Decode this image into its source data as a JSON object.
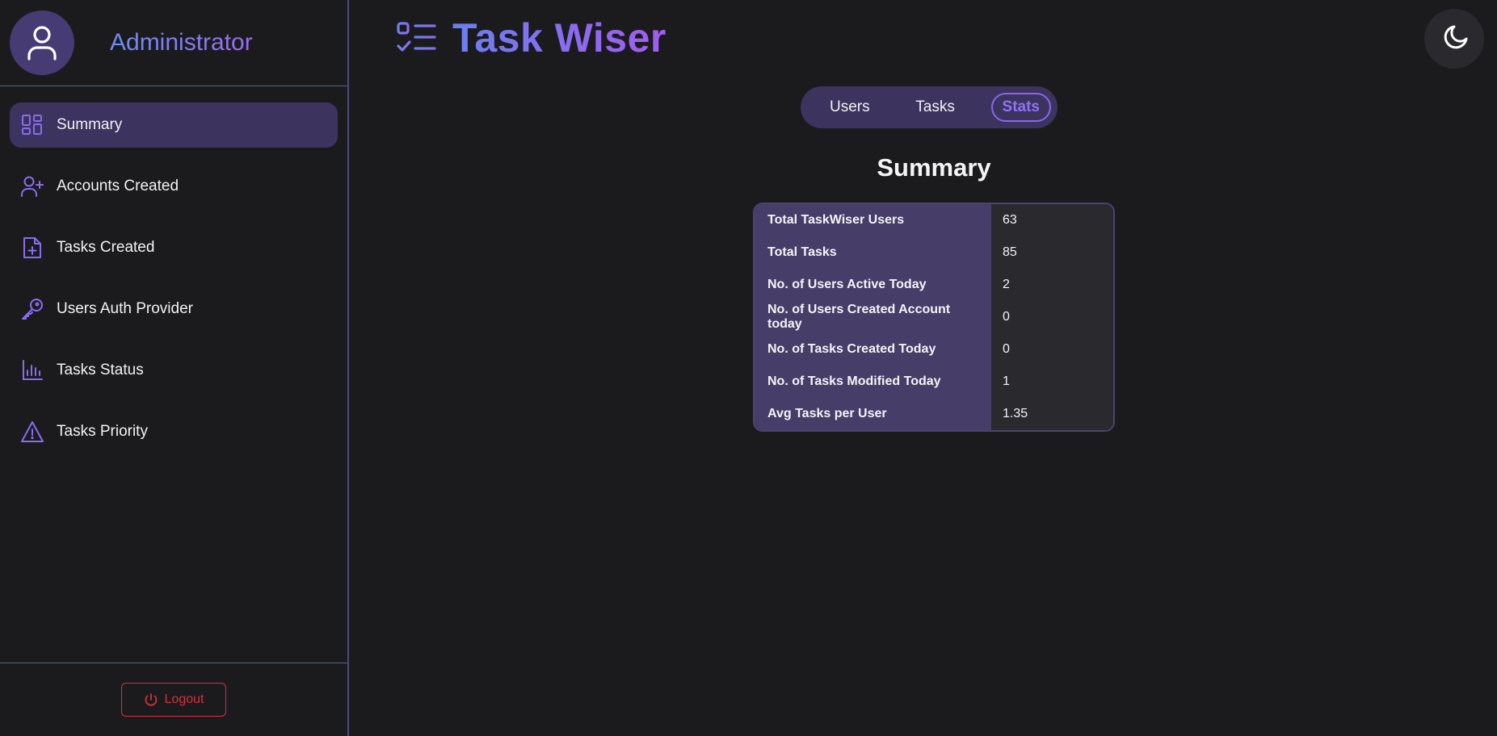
{
  "sidebar": {
    "profile_name": "Administrator",
    "items": [
      {
        "label": "Summary",
        "icon": "layout-dashboard-icon"
      },
      {
        "label": "Accounts Created",
        "icon": "user-plus-icon"
      },
      {
        "label": "Tasks Created",
        "icon": "file-plus-icon"
      },
      {
        "label": "Users Auth Provider",
        "icon": "key-icon"
      },
      {
        "label": "Tasks Status",
        "icon": "bar-chart-icon"
      },
      {
        "label": "Tasks Priority",
        "icon": "alert-triangle-icon"
      }
    ],
    "active_index": 0,
    "logout_label": "Logout"
  },
  "header": {
    "title": "Task Wiser",
    "logo_icon": "checklist-icon",
    "theme_toggle_icon": "moon-icon"
  },
  "tabs": {
    "items": [
      "Users",
      "Tasks",
      "Stats"
    ],
    "active": "Stats"
  },
  "summary": {
    "title": "Summary",
    "rows": [
      {
        "label": "Total TaskWiser Users",
        "value": "63"
      },
      {
        "label": "Total Tasks",
        "value": "85"
      },
      {
        "label": "No. of Users Active Today",
        "value": "2"
      },
      {
        "label": "No. of Users Created Account today",
        "value": "0"
      },
      {
        "label": "No. of Tasks Created Today",
        "value": "0"
      },
      {
        "label": "No. of Tasks Modified Today",
        "value": "1"
      },
      {
        "label": "Avg Tasks per User",
        "value": "1.35"
      }
    ]
  },
  "colors": {
    "accent": "#8866ee",
    "sidebar_active_bg": "#3d335f",
    "danger": "#d6303b",
    "background": "#1b1b1e"
  }
}
